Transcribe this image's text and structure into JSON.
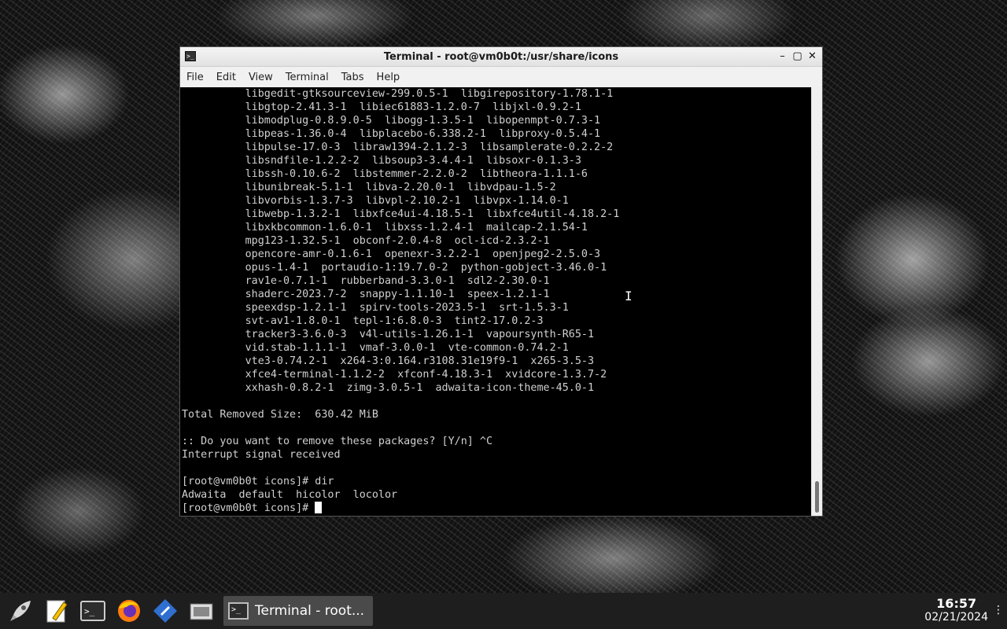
{
  "window": {
    "title": "Terminal - root@vm0b0t:/usr/share/icons",
    "controls": {
      "minimize": "–",
      "maximize": "▢",
      "close": "✕"
    }
  },
  "menu": [
    "File",
    "Edit",
    "View",
    "Terminal",
    "Tabs",
    "Help"
  ],
  "terminal": {
    "lines": [
      "          libgedit-gtksourceview-299.0.5-1  libgirepository-1.78.1-1",
      "          libgtop-2.41.3-1  libiec61883-1.2.0-7  libjxl-0.9.2-1",
      "          libmodplug-0.8.9.0-5  libogg-1.3.5-1  libopenmpt-0.7.3-1",
      "          libpeas-1.36.0-4  libplacebo-6.338.2-1  libproxy-0.5.4-1",
      "          libpulse-17.0-3  libraw1394-2.1.2-3  libsamplerate-0.2.2-2",
      "          libsndfile-1.2.2-2  libsoup3-3.4.4-1  libsoxr-0.1.3-3",
      "          libssh-0.10.6-2  libstemmer-2.2.0-2  libtheora-1.1.1-6",
      "          libunibreak-5.1-1  libva-2.20.0-1  libvdpau-1.5-2",
      "          libvorbis-1.3.7-3  libvpl-2.10.2-1  libvpx-1.14.0-1",
      "          libwebp-1.3.2-1  libxfce4ui-4.18.5-1  libxfce4util-4.18.2-1",
      "          libxkbcommon-1.6.0-1  libxss-1.2.4-1  mailcap-2.1.54-1",
      "          mpg123-1.32.5-1  obconf-2.0.4-8  ocl-icd-2.3.2-1",
      "          opencore-amr-0.1.6-1  openexr-3.2.2-1  openjpeg2-2.5.0-3",
      "          opus-1.4-1  portaudio-1:19.7.0-2  python-gobject-3.46.0-1",
      "          rav1e-0.7.1-1  rubberband-3.3.0-1  sdl2-2.30.0-1",
      "          shaderc-2023.7-2  snappy-1.1.10-1  speex-1.2.1-1",
      "          speexdsp-1.2.1-1  spirv-tools-2023.5-1  srt-1.5.3-1",
      "          svt-av1-1.8.0-1  tepl-1:6.8.0-3  tint2-17.0.2-3",
      "          tracker3-3.6.0-3  v4l-utils-1.26.1-1  vapoursynth-R65-1",
      "          vid.stab-1.1.1-1  vmaf-3.0.0-1  vte-common-0.74.2-1",
      "          vte3-0.74.2-1  x264-3:0.164.r3108.31e19f9-1  x265-3.5-3",
      "          xfce4-terminal-1.1.2-2  xfconf-4.18.3-1  xvidcore-1.3.7-2",
      "          xxhash-0.8.2-1  zimg-3.0.5-1  adwaita-icon-theme-45.0-1",
      "",
      "Total Removed Size:  630.42 MiB",
      "",
      ":: Do you want to remove these packages? [Y/n] ^C",
      "Interrupt signal received",
      "",
      "[root@vm0b0t icons]# dir",
      "Adwaita  default  hicolor  locolor"
    ],
    "prompt": "[root@vm0b0t icons]# "
  },
  "taskbar": {
    "launchers": [
      "rocket-icon",
      "text-editor-icon",
      "terminal-icon",
      "firefox-icon",
      "app-icon",
      "screenshot-icon"
    ],
    "task_label": "Terminal - root...",
    "time": "16:57",
    "date": "02/21/2024"
  }
}
